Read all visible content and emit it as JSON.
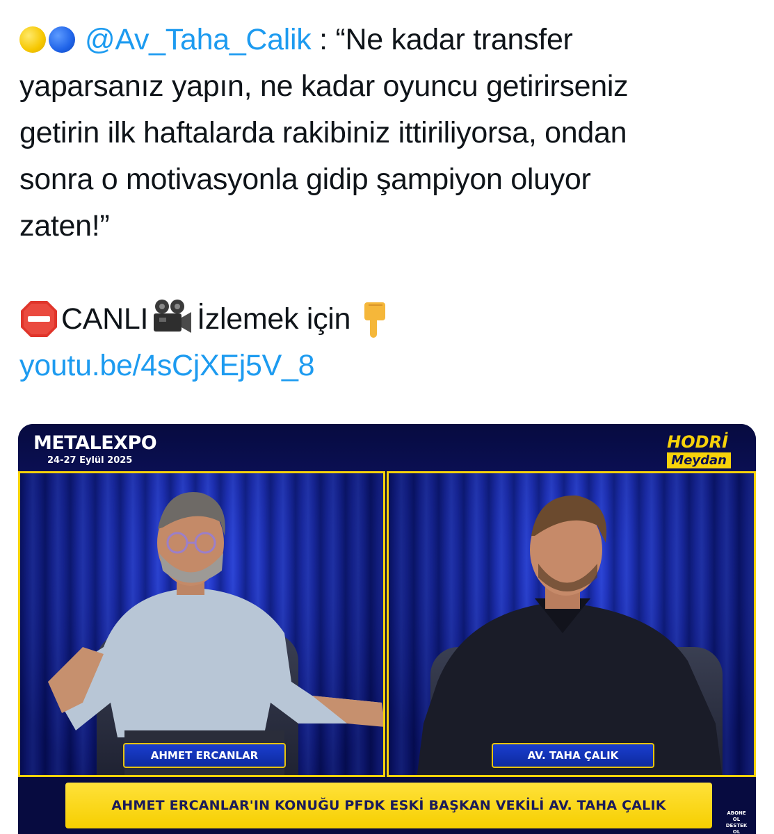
{
  "tweet": {
    "mention": "@Av_Taha_Calik",
    "lines": [
      " : “Ne kadar transfer",
      "yaparsanız yapın, ne kadar oyuncu getirirseniz",
      "getirin ilk haftalarda rakibiniz ittiriliyorsa, ondan",
      "sonra o motivasyonla gidip şampiyon oluyor",
      "zaten!”"
    ],
    "live_label": "CANLI",
    "watch_label": "İzlemek için",
    "link": "youtu.be/4sCjXEj5V_8",
    "emoji_icons": [
      "yellow-circle-icon",
      "blue-circle-icon",
      "stop-sign-icon",
      "movie-camera-icon",
      "pointing-down-hand-icon"
    ]
  },
  "media": {
    "brand": "METALEXPO",
    "brand_date": "24-27 Eylül 2025",
    "show_title": "HODRİ",
    "show_subtitle": "Meydan",
    "left_name": "AHMET ERCANLAR",
    "right_name": "AV. TAHA ÇALIK",
    "banner": "AHMET ERCANLAR'IN KONUĞU PFDK ESKİ BAŞKAN VEKİLİ AV. TAHA ÇALIK",
    "subscribe_line1": "ABONE OL",
    "subscribe_line2": "DESTEK OL"
  },
  "colors": {
    "link": "#1d9bf0",
    "accent_yellow": "#f7d20a",
    "navy": "#070b40"
  }
}
